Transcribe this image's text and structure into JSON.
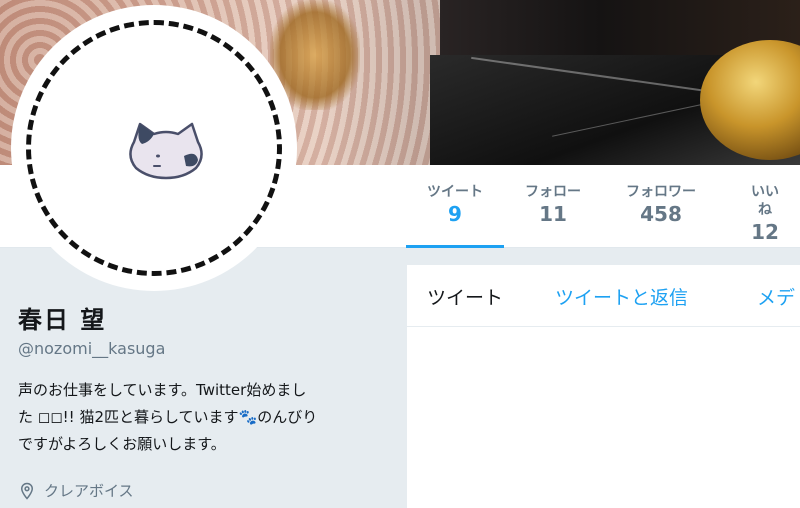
{
  "profile": {
    "display_name": "春日 望",
    "handle": "@nozomi__kasuga",
    "bio_line1": "声のお仕事をしています。Twitter始めまし",
    "bio_line2a": "た ◻◻!! 猫2匹と暮らしています",
    "bio_paw": "🐾",
    "bio_line2b": "のんびり",
    "bio_line3": "ですがよろしくお願いします。",
    "location": "クレアボイス",
    "avatar_icon": "cat-face-icon"
  },
  "stats": [
    {
      "label": "ツイート",
      "value": "9"
    },
    {
      "label": "フォロー",
      "value": "11"
    },
    {
      "label": "フォロワー",
      "value": "458"
    },
    {
      "label": "いいね",
      "value": "12"
    }
  ],
  "timeline": {
    "tabs": [
      "ツイート",
      "ツイートと返信",
      "メデ"
    ]
  },
  "colors": {
    "accent": "#1da1f2",
    "text": "#14171a",
    "muted": "#657786",
    "background": "#e6ecf0"
  }
}
